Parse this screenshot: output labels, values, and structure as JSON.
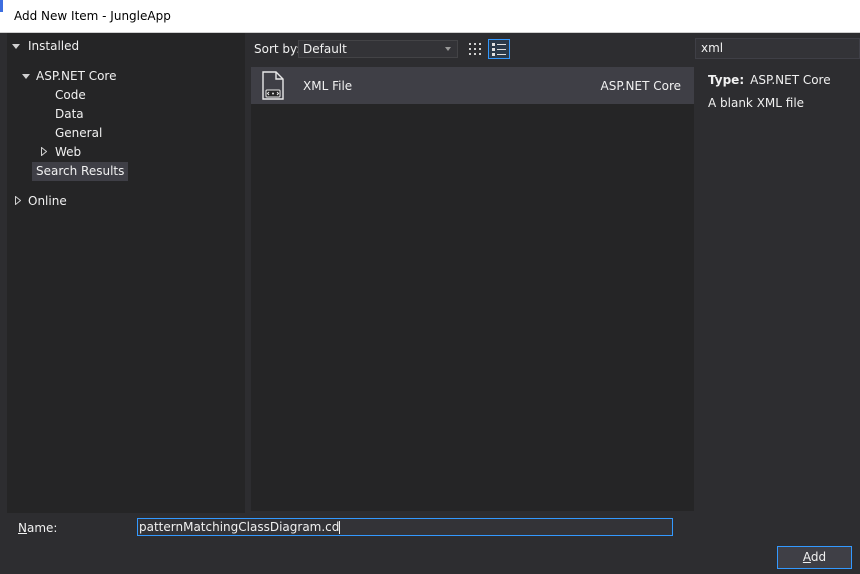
{
  "window": {
    "title": "Add New Item - JungleApp"
  },
  "tree": {
    "installed_label": "Installed",
    "group_label": "ASP.NET Core",
    "children": [
      "Code",
      "Data",
      "General",
      "Web"
    ],
    "search_results_label": "Search Results",
    "online_label": "Online"
  },
  "toolbar": {
    "sort_label": "Sort by:",
    "sort_value": "Default"
  },
  "search": {
    "value": "xml"
  },
  "items": [
    {
      "name": "XML File",
      "category": "ASP.NET Core",
      "icon": "xml-file-icon"
    }
  ],
  "details": {
    "type_label": "Type:",
    "type_value": "ASP.NET Core",
    "description": "A blank XML file"
  },
  "name_field": {
    "label": "Name:",
    "value": "patternMatchingClassDiagram.cd"
  },
  "buttons": {
    "add_label": "Add"
  },
  "colors": {
    "background": "#2d2d30",
    "pane": "#252526",
    "selected": "#3f3f46",
    "accent": "#3399ff"
  }
}
